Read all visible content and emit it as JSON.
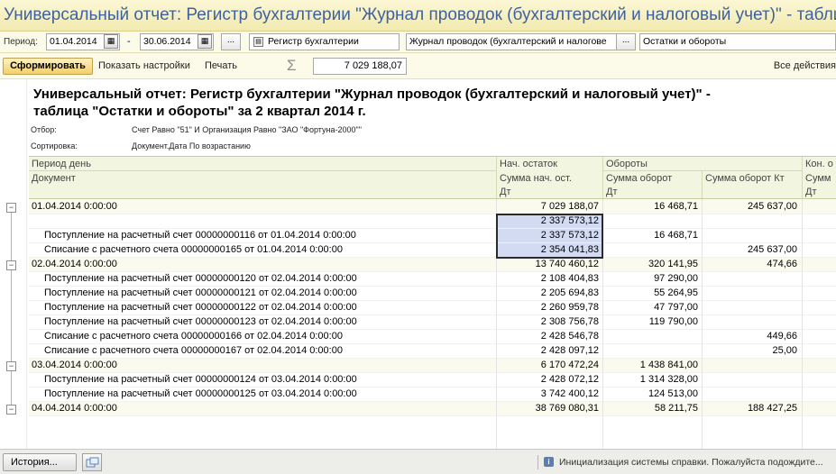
{
  "window": {
    "title": "Универсальный отчет: Регистр бухгалтерии \"Журнал проводок (бухгалтерский и налоговый учет)\" - таблица"
  },
  "params": {
    "period_label": "Период:",
    "date_from": "01.04.2014",
    "dash": "-",
    "date_to": "30.06.2014",
    "dots_label": "...",
    "register_type": "Регистр бухгалтерии",
    "register_name": "Журнал проводок (бухгалтерский и налогове",
    "report_kind": "Остатки и обороты"
  },
  "toolbar": {
    "generate_label": "Сформировать",
    "show_settings_label": "Показать настройки",
    "print_label": "Печать",
    "sigma": "Σ",
    "sum_value": "7 029 188,07",
    "all_actions_label": "Все действия"
  },
  "report": {
    "title": "Универсальный отчет: Регистр бухгалтерии \"Журнал проводок (бухгалтерский и налоговый учет)\" - таблица \"Остатки и обороты\" за 2 квартал 2014 г.",
    "filter_label": "Отбор:",
    "filter_value": "Счет Равно \"51\" И Организация Равно \"ЗАО \"Фортуна-2000\"\"",
    "sort_label": "Сортировка:",
    "sort_value": "Документ.Дата По возрастанию",
    "headers": {
      "period": "Период день",
      "document": "Документ",
      "opening": "Нач. остаток",
      "opening_sub1": "Сумма нач. ост.",
      "opening_sub2": "Дт",
      "turnover": "Обороты",
      "turnover_dt1": "Сумма оборот",
      "turnover_dt2": "Дт",
      "turnover_kt": "Сумма оборот Кт",
      "closing": "Кон. о",
      "closing_sub": "Сумм",
      "closing_sub2": "Дт"
    },
    "rows": [
      {
        "name": "01.04.2014 0:00:00",
        "open": "7 029 188,07",
        "dt": "16 468,71",
        "kt": "245 637,00",
        "group": true
      },
      {
        "name": "",
        "open": "2 337 573,12",
        "dt": "",
        "kt": "",
        "group": false,
        "sel": true
      },
      {
        "name": "Поступление на расчетный счет 00000000116 от 01.04.2014 0:00:00",
        "open": "2 337 573,12",
        "dt": "16 468,71",
        "kt": "",
        "group": false,
        "sel": true
      },
      {
        "name": "Списание с расчетного счета 00000000165 от 01.04.2014 0:00:00",
        "open": "2 354 041,83",
        "dt": "",
        "kt": "245 637,00",
        "group": false,
        "sel": true
      },
      {
        "name": "02.04.2014 0:00:00",
        "open": "13 740 460,12",
        "dt": "320 141,95",
        "kt": "474,66",
        "group": true
      },
      {
        "name": "Поступление на расчетный счет 00000000120 от 02.04.2014 0:00:00",
        "open": "2 108 404,83",
        "dt": "97 290,00",
        "kt": "",
        "group": false
      },
      {
        "name": "Поступление на расчетный счет 00000000121 от 02.04.2014 0:00:00",
        "open": "2 205 694,83",
        "dt": "55 264,95",
        "kt": "",
        "group": false
      },
      {
        "name": "Поступление на расчетный счет 00000000122 от 02.04.2014 0:00:00",
        "open": "2 260 959,78",
        "dt": "47 797,00",
        "kt": "",
        "group": false
      },
      {
        "name": "Поступление на расчетный счет 00000000123 от 02.04.2014 0:00:00",
        "open": "2 308 756,78",
        "dt": "119 790,00",
        "kt": "",
        "group": false
      },
      {
        "name": "Списание с расчетного счета 00000000166 от 02.04.2014 0:00:00",
        "open": "2 428 546,78",
        "dt": "",
        "kt": "449,66",
        "group": false
      },
      {
        "name": "Списание с расчетного счета 00000000167 от 02.04.2014 0:00:00",
        "open": "2 428 097,12",
        "dt": "",
        "kt": "25,00",
        "group": false
      },
      {
        "name": "03.04.2014 0:00:00",
        "open": "6 170 472,24",
        "dt": "1 438 841,00",
        "kt": "",
        "group": true
      },
      {
        "name": "Поступление на расчетный счет 00000000124 от 03.04.2014 0:00:00",
        "open": "2 428 072,12",
        "dt": "1 314 328,00",
        "kt": "",
        "group": false
      },
      {
        "name": "Поступление на расчетный счет 00000000125 от 03.04.2014 0:00:00",
        "open": "3 742 400,12",
        "dt": "124 513,00",
        "kt": "",
        "group": false
      },
      {
        "name": "04.04.2014 0:00:00",
        "open": "38 769 080,31",
        "dt": "58 211,75",
        "kt": "188 427,25",
        "group": true
      }
    ]
  },
  "status": {
    "history_label": "История...",
    "message": "Инициализация системы справки. Пожалуйста подождите..."
  },
  "colors": {
    "title_text": "#3f61a0",
    "header_bg": "#f2f5e0",
    "selection_bg": "#d3dbf3",
    "generate_button": "#f3cf68"
  }
}
